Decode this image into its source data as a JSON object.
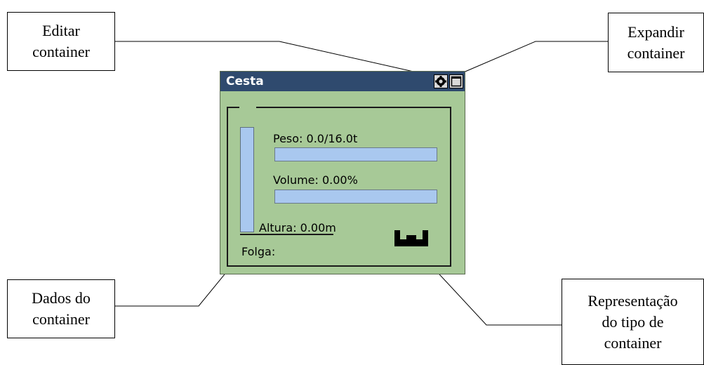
{
  "window": {
    "title": "Cesta"
  },
  "container_data": {
    "peso_label": "Peso: 0.0/16.0t",
    "peso_fill": 0.0,
    "volume_label": "Volume: 0.00%",
    "volume_fill": 0.0,
    "altura_label": "Altura: 0.00m",
    "folga_label": "Folga:"
  },
  "callouts": {
    "editar": [
      "Editar",
      "container"
    ],
    "expandir": [
      "Expandir",
      "container"
    ],
    "dados": [
      "Dados do",
      "container"
    ],
    "representacao": [
      "Representação",
      "do tipo de",
      "container"
    ]
  },
  "icons": {
    "gear": "gear-icon",
    "expand": "maximize-icon",
    "container_type": "open-top-container-icon"
  },
  "colors": {
    "titlebar": "#2f4a6e",
    "panel": "#a7c997",
    "bar_fill": "#a9c8ef"
  }
}
